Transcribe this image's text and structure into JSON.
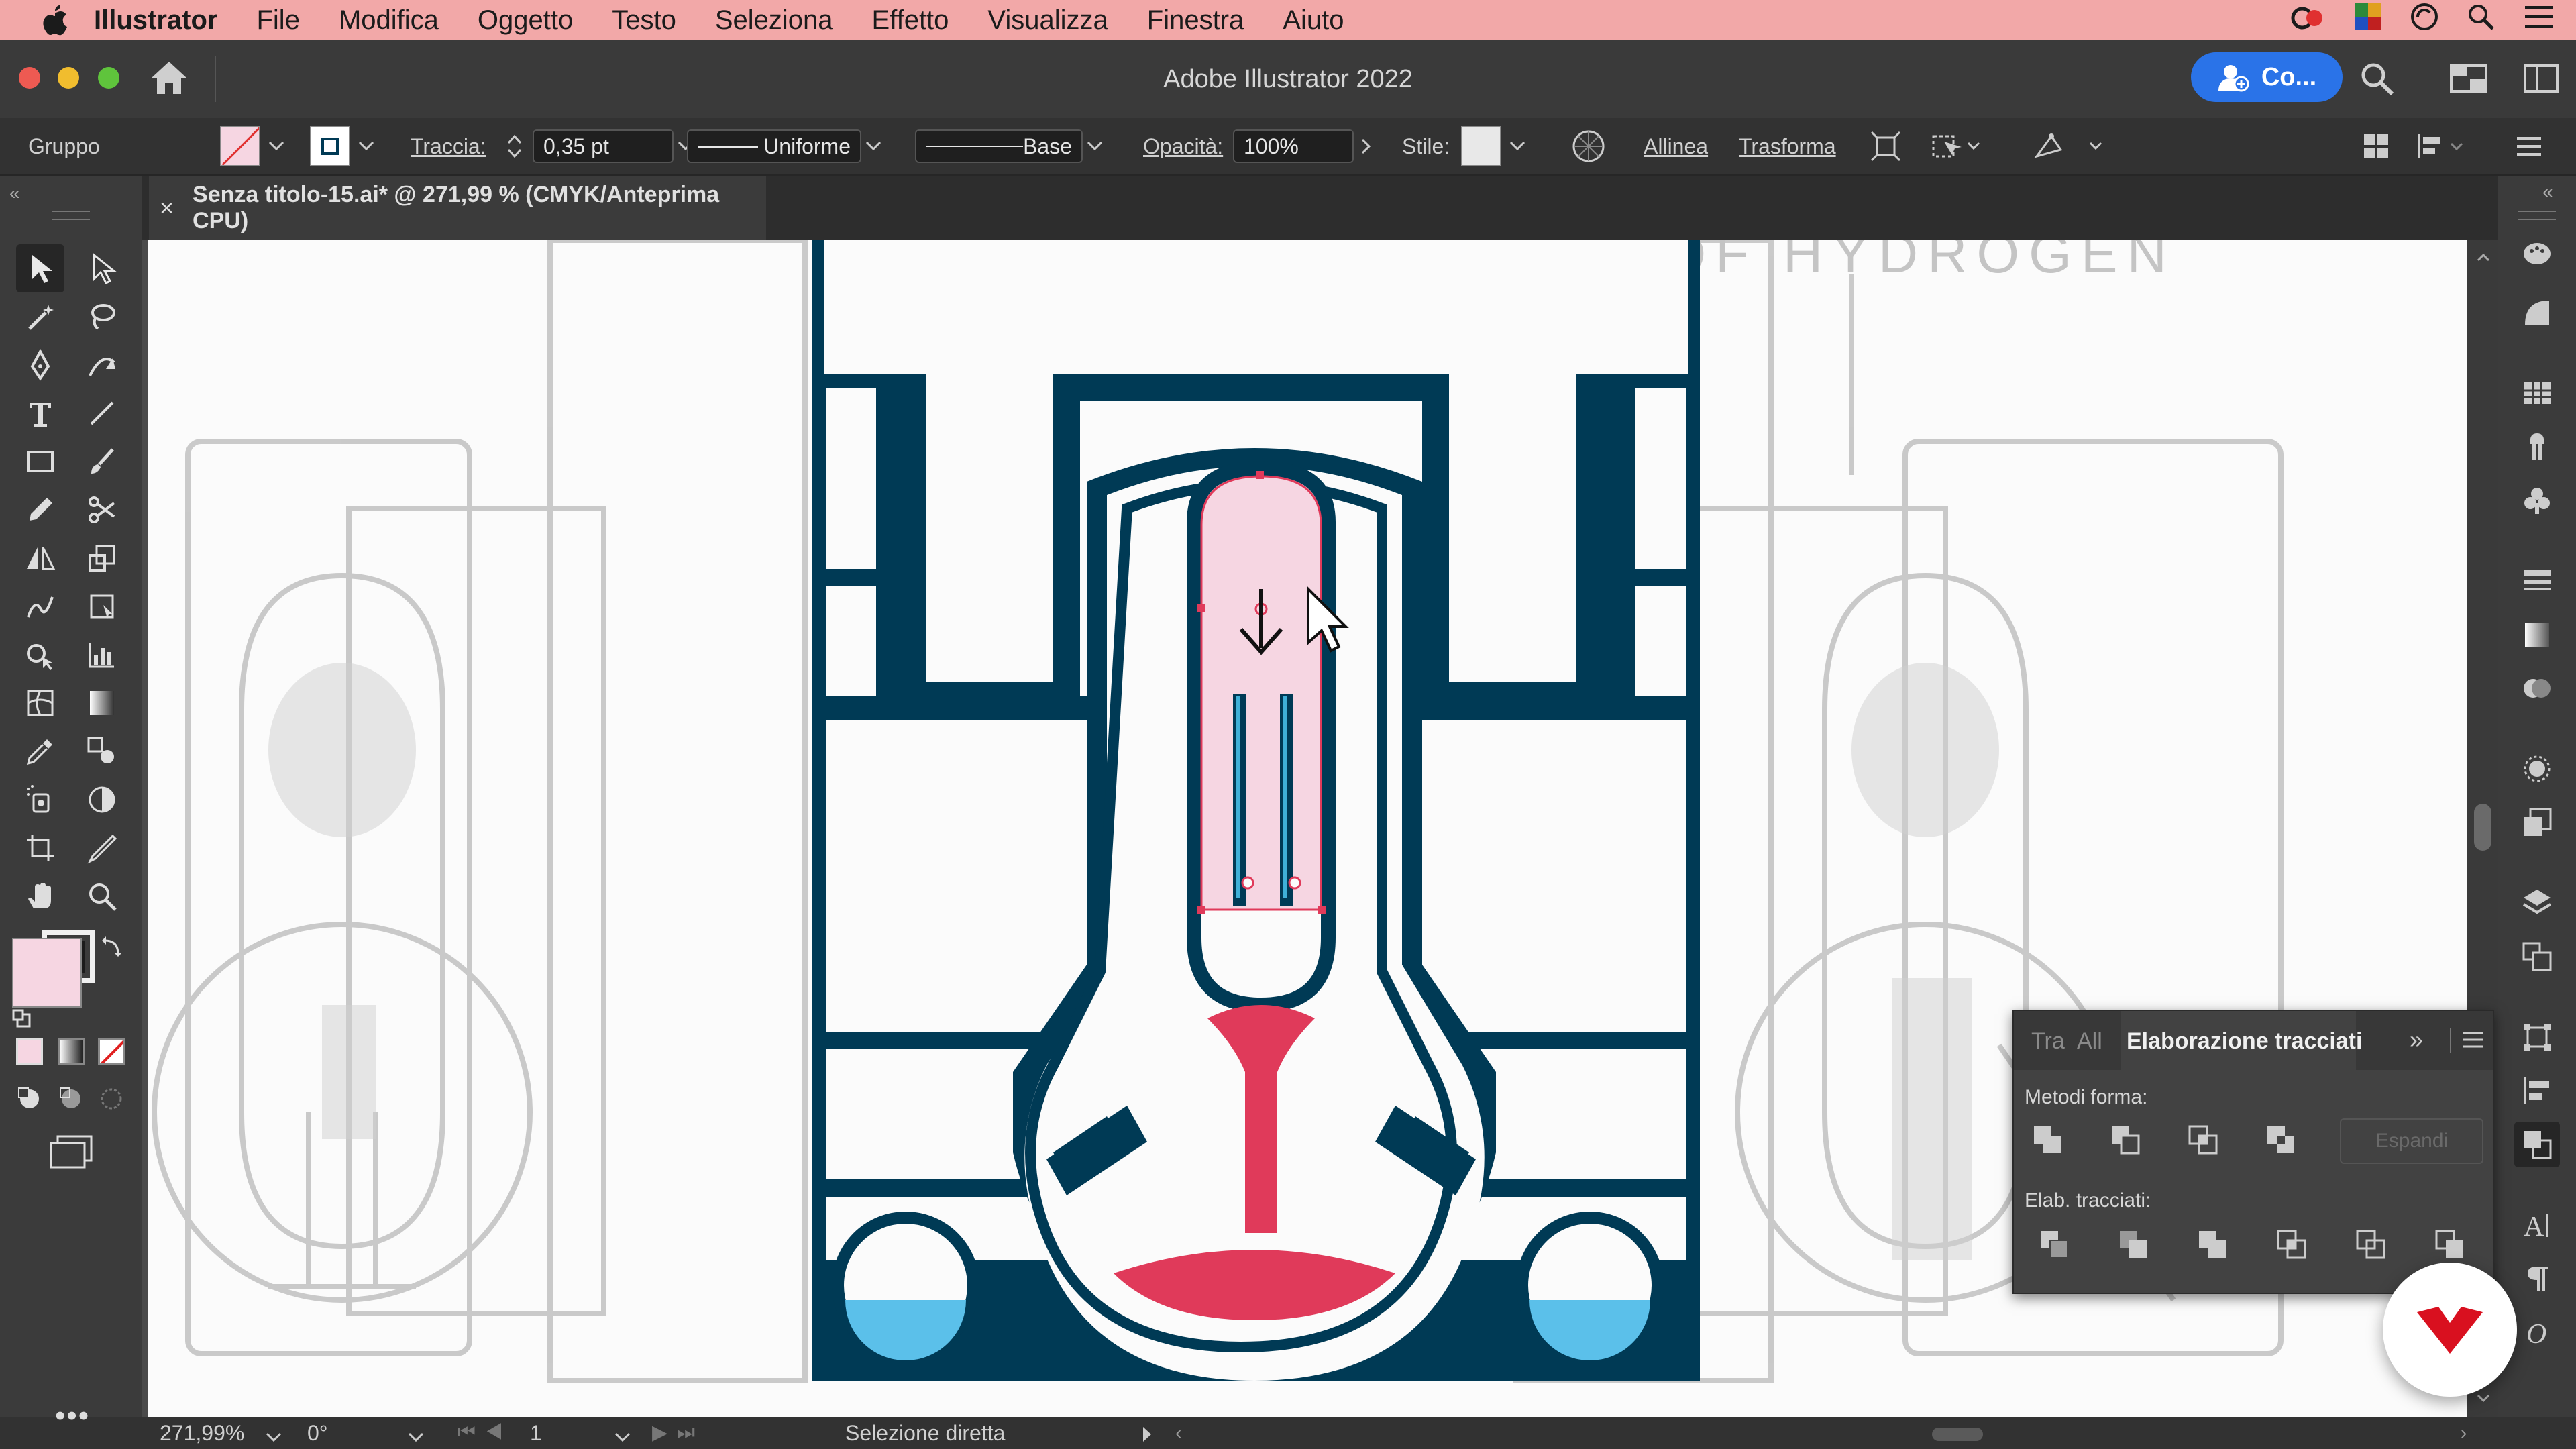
{
  "menubar": {
    "app_name": "Illustrator",
    "items": [
      "File",
      "Modifica",
      "Oggetto",
      "Testo",
      "Seleziona",
      "Effetto",
      "Visualizza",
      "Finestra",
      "Aiuto"
    ],
    "status_icons": [
      "creative-cloud-icon",
      "color-widget-icon",
      "sync-icon",
      "spotlight-search-icon",
      "control-center-icon"
    ]
  },
  "titlebar": {
    "title": "Adobe Illustrator 2022",
    "share_label": "Co..."
  },
  "controlbar": {
    "selection_type": "Gruppo",
    "stroke_label": "Traccia:",
    "stroke_value": "0,35 pt",
    "profile_label": "Uniforme",
    "brush_label": "Base",
    "opacity_label": "Opacità:",
    "opacity_value": "100%",
    "style_label": "Stile:",
    "align_label": "Allinea",
    "transform_label": "Trasforma",
    "fill_color": "#f6d6e2"
  },
  "document": {
    "tab_title": "Senza titolo-15.ai* @ 271,99 % (CMYK/Anteprima CPU)"
  },
  "statusbar": {
    "zoom": "271,99%",
    "rotation": "0°",
    "artboard_number": "1",
    "tool_status": "Selezione diretta"
  },
  "pathfinder_panel": {
    "tabs": [
      "Tra",
      "All",
      "Elaborazione tracciati"
    ],
    "shape_modes_label": "Metodi forma:",
    "pathfinders_label": "Elab. tracciati:",
    "expand_label": "Espandi"
  },
  "artwork": {
    "sketch_text": "GASES OF HYDROGEN",
    "colors": {
      "navy": "#003a55",
      "pink": "#f6d6e2",
      "red": "#e03a5a",
      "blue": "#5bc0ea"
    }
  },
  "colors": {
    "accent_blue": "#2a73e8",
    "menubar_bg": "#f2a8a8",
    "ui_dark": "#323232"
  }
}
